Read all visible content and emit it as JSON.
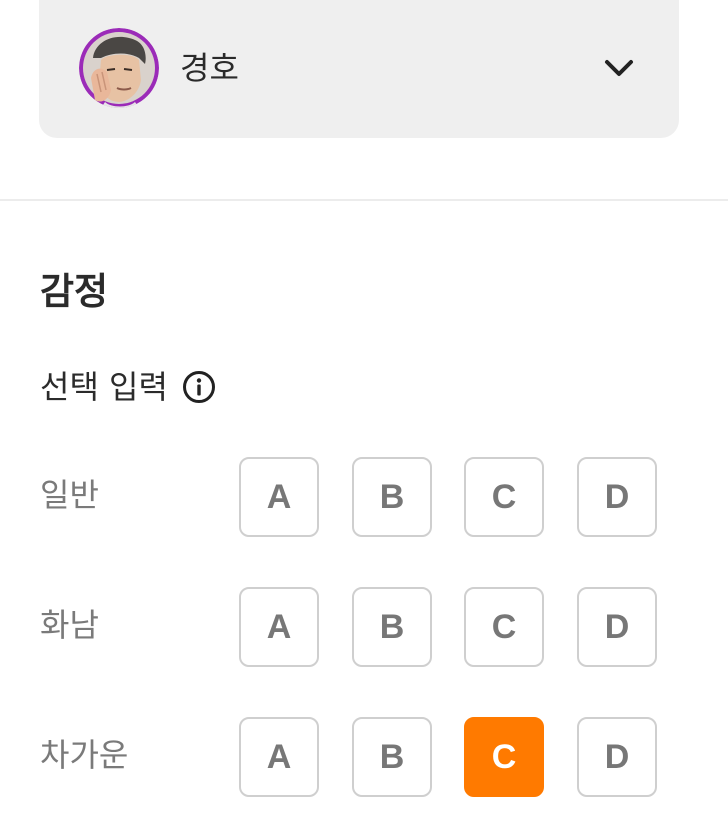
{
  "character": {
    "name": "경호",
    "avatar_icon": "character-portrait",
    "dropdown_icon": "chevron-down-icon"
  },
  "emotion": {
    "title": "감정",
    "input_mode_label": "선택 입력",
    "info_icon": "info-circle-icon",
    "rows": [
      {
        "label": "일반",
        "options": [
          "A",
          "B",
          "C",
          "D"
        ],
        "selected": null
      },
      {
        "label": "화남",
        "options": [
          "A",
          "B",
          "C",
          "D"
        ],
        "selected": null
      },
      {
        "label": "차가운",
        "options": [
          "A",
          "B",
          "C",
          "D"
        ],
        "selected": "C"
      }
    ]
  },
  "colors": {
    "accent": "#ff7a00",
    "panel_bg": "#efefef",
    "option_border": "#cfcfcf",
    "avatar_ring": "#9b2bb8"
  }
}
